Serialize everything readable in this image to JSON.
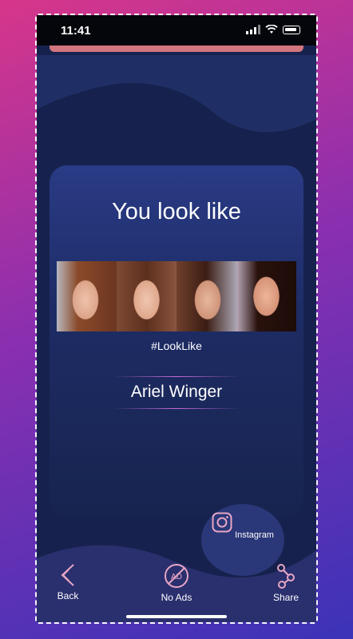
{
  "status": {
    "time": "11:41"
  },
  "result": {
    "title": "You look like",
    "hashtag": "#LookLike",
    "celebrity_name": "Ariel Winger"
  },
  "share_targets": [
    {
      "label": "Instagram",
      "icon": "instagram-icon"
    }
  ],
  "bottom_nav": {
    "back_label": "Back",
    "no_ads_label": "No Ads",
    "no_ads_icon_text": "AD",
    "share_label": "Share"
  },
  "colors": {
    "background_start": "#d7368a",
    "background_end": "#3b33b8",
    "screen": "#16224d",
    "card": "#2a3b86",
    "accent_pink": "#e7a6c4"
  }
}
